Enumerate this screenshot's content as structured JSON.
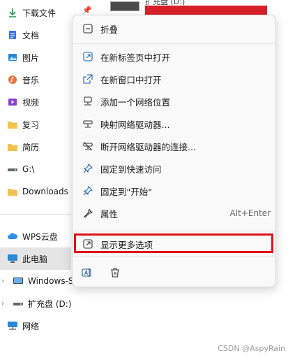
{
  "sidebar": {
    "items": [
      {
        "label": "下载文件",
        "icon": "download-icon"
      },
      {
        "label": "文档",
        "icon": "document-icon"
      },
      {
        "label": "图片",
        "icon": "picture-icon"
      },
      {
        "label": "音乐",
        "icon": "music-icon"
      },
      {
        "label": "视频",
        "icon": "video-icon"
      },
      {
        "label": "复习",
        "icon": "folder-icon"
      },
      {
        "label": "简历",
        "icon": "folder-icon"
      },
      {
        "label": "G:\\",
        "icon": "drive-icon"
      },
      {
        "label": "Downloads",
        "icon": "folder-icon"
      },
      {
        "label": "WPS云盘",
        "icon": "cloud-icon"
      },
      {
        "label": "此电脑",
        "icon": "computer-icon"
      },
      {
        "label": "Windows-S",
        "icon": "drive-icon"
      },
      {
        "label": "扩充盘 (D:)",
        "icon": "drive-icon"
      },
      {
        "label": "网络",
        "icon": "network-icon"
      }
    ]
  },
  "background": {
    "drive_label": "扩充盘 (D:)"
  },
  "menu": {
    "items": [
      {
        "label": "折叠",
        "icon": "collapse-icon"
      },
      {
        "label": "在新标签页中打开",
        "icon": "open-new-tab-icon"
      },
      {
        "label": "在新窗口中打开",
        "icon": "open-new-window-icon"
      },
      {
        "label": "添加一个网络位置",
        "icon": "network-location-icon"
      },
      {
        "label": "映射网络驱动器...",
        "icon": "map-drive-icon"
      },
      {
        "label": "断开网络驱动器的连接...",
        "icon": "disconnect-drive-icon"
      },
      {
        "label": "固定到快速访问",
        "icon": "pin-icon"
      },
      {
        "label": "固定到\"开始\"",
        "icon": "pin-icon"
      },
      {
        "label": "属性",
        "icon": "wrench-icon",
        "shortcut": "Alt+Enter"
      },
      {
        "label": "显示更多选项",
        "icon": "more-options-icon"
      }
    ],
    "bottom_icons": [
      "rename-icon",
      "delete-icon"
    ],
    "highlight_color": "#e0101a"
  },
  "watermark": "CSDN @AspyRain"
}
